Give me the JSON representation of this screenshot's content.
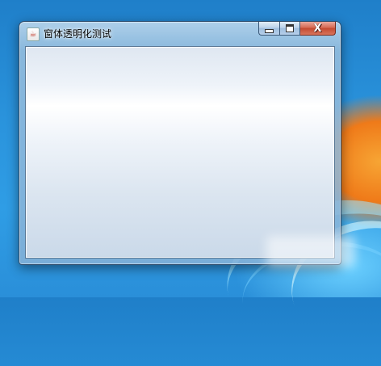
{
  "window": {
    "title": "窗体透明化测试",
    "app_icon": "java-cup-icon"
  },
  "controls": {
    "minimize_icon": "minimize-icon",
    "maximize_icon": "maximize-icon",
    "close_icon": "close-icon",
    "close_symbol": "X"
  },
  "colors": {
    "desktop_blue": "#2a93dc",
    "close_red": "#c44a30",
    "frame_glass": "#8fb5d9"
  }
}
